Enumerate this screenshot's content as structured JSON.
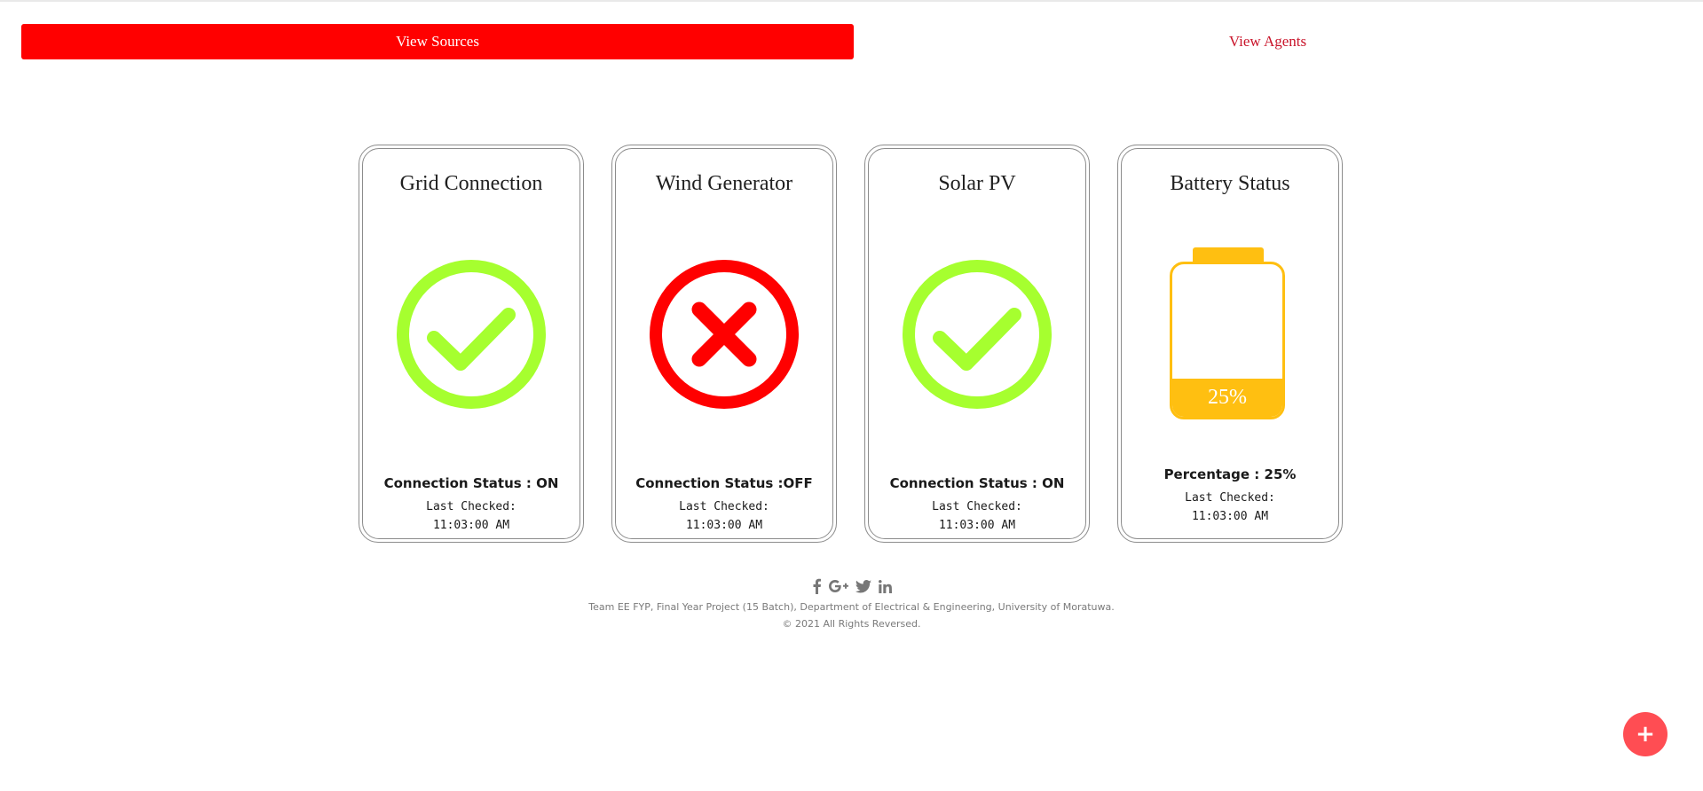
{
  "nav": {
    "sources_label": "View Sources",
    "agents_label": "View Agents"
  },
  "colors": {
    "active_tab": "#ff0000",
    "inactive_tab_text": "#c9142a",
    "status_on": "#a6ff2f",
    "status_off": "#ff0000",
    "battery": "#ffbf11",
    "fab": "#ff4d53"
  },
  "cards": [
    {
      "title": "Grid Connection",
      "icon": "check-circle-icon",
      "status_text": "Connection Status : ON",
      "checked_label": "Last Checked:",
      "checked_time": "11:03:00 AM"
    },
    {
      "title": "Wind Generator",
      "icon": "x-circle-icon",
      "status_text": "Connection Status :OFF",
      "checked_label": "Last Checked:",
      "checked_time": "11:03:00 AM"
    },
    {
      "title": "Solar PV",
      "icon": "check-circle-icon",
      "status_text": "Connection Status : ON",
      "checked_label": "Last Checked:",
      "checked_time": "11:03:00 AM"
    }
  ],
  "battery": {
    "title": "Battery Status",
    "level_percent": 25,
    "level_text": "25%",
    "status_text": "Percentage : 25%",
    "checked_label": "Last Checked:",
    "checked_time": "11:03:00 AM"
  },
  "footer": {
    "social_icons": [
      "facebook-icon",
      "google-plus-icon",
      "twitter-icon",
      "linkedin-icon"
    ],
    "credit": "Team EE FYP, Final Year Project (15 Batch), Department of Electrical & Engineering, University of Moratuwa.",
    "copyright": "© 2021 All Rights Reversed."
  },
  "fab": {
    "symbol": "+"
  }
}
